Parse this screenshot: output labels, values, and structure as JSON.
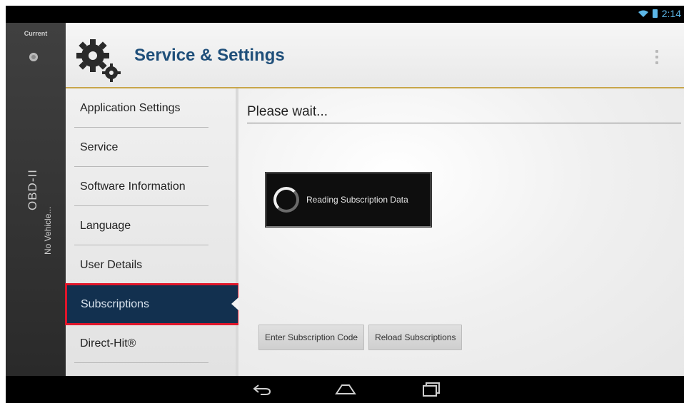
{
  "status_bar": {
    "time": "2:14",
    "wifi_icon": "wifi-icon",
    "battery_icon": "battery-icon"
  },
  "left_rail": {
    "current_label": "Current",
    "obd_label": "OBD-II",
    "vehicle_label": "No Vehicle..."
  },
  "header": {
    "title": "Service & Settings",
    "icon": "gear-icon",
    "menu_icon": "overflow-menu-icon"
  },
  "menu": {
    "items": [
      {
        "label": "Application Settings"
      },
      {
        "label": "Service"
      },
      {
        "label": "Software Information"
      },
      {
        "label": "Language"
      },
      {
        "label": "User Details"
      },
      {
        "label": "Subscriptions",
        "active": true
      },
      {
        "label": "Direct-Hit®"
      }
    ]
  },
  "content": {
    "title": "Please wait...",
    "dialog_message": "Reading Subscription Data",
    "buttons": {
      "enter_code": "Enter Subscription Code",
      "reload": "Reload Subscriptions"
    }
  },
  "nav_bar": {
    "back_icon": "back-icon",
    "home_icon": "home-icon",
    "recents_icon": "recents-icon"
  },
  "colors": {
    "header_title": "#1f4f7a",
    "active_bg": "#12304f",
    "highlight": "#e1162a",
    "gold_line": "#c8a64a"
  }
}
